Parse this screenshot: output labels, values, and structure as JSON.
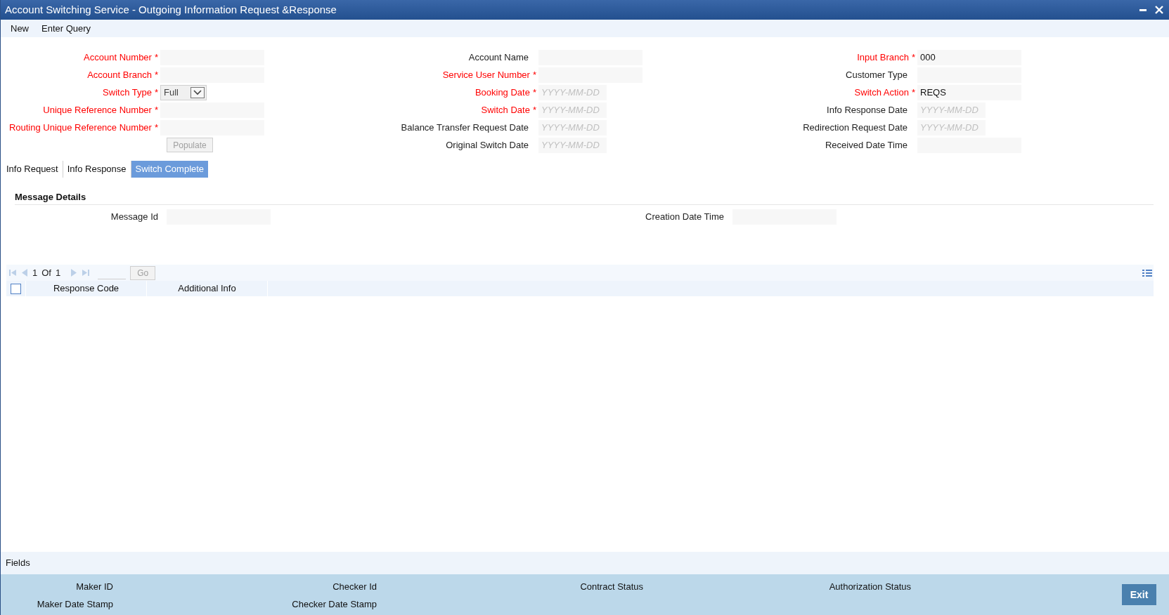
{
  "window": {
    "title": "Account Switching Service - Outgoing Information Request &Response"
  },
  "menu": [
    {
      "label": "New"
    },
    {
      "label": "Enter Query"
    }
  ],
  "required_marker": "*",
  "form_columns": [
    [
      {
        "label": "Account Number",
        "required": true,
        "kind": "text"
      },
      {
        "label": "Account Branch",
        "required": true,
        "kind": "text"
      },
      {
        "label": "Switch Type",
        "required": true,
        "kind": "select",
        "value": "Full"
      },
      {
        "label": "Unique Reference Number",
        "required": true,
        "kind": "text"
      },
      {
        "label": "Routing Unique Reference Number",
        "required": true,
        "kind": "text"
      },
      {
        "label": "Populate",
        "kind": "button"
      }
    ],
    [
      {
        "label": "Account Name",
        "required": false,
        "kind": "text"
      },
      {
        "label": "Service User Number",
        "required": true,
        "kind": "text"
      },
      {
        "label": "Booking Date",
        "required": true,
        "kind": "date",
        "placeholder": "YYYY-MM-DD"
      },
      {
        "label": "Switch Date",
        "required": true,
        "kind": "date",
        "placeholder": "YYYY-MM-DD"
      },
      {
        "label": "Balance Transfer Request Date",
        "required": false,
        "kind": "date",
        "placeholder": "YYYY-MM-DD"
      },
      {
        "label": "Original Switch Date",
        "required": false,
        "kind": "date",
        "placeholder": "YYYY-MM-DD"
      }
    ],
    [
      {
        "label": "Input Branch",
        "required": true,
        "kind": "text",
        "value": "000"
      },
      {
        "label": "Customer Type",
        "required": false,
        "kind": "text"
      },
      {
        "label": "Switch Action",
        "required": true,
        "kind": "text",
        "value": "REQS"
      },
      {
        "label": "Info Response Date",
        "required": false,
        "kind": "date",
        "placeholder": "YYYY-MM-DD"
      },
      {
        "label": "Redirection Request Date",
        "required": false,
        "kind": "date",
        "placeholder": "YYYY-MM-DD"
      },
      {
        "label": "Received Date Time",
        "required": false,
        "kind": "text"
      }
    ]
  ],
  "tabs": [
    {
      "label": "Info Request",
      "selected": false
    },
    {
      "label": "Info Response",
      "selected": false
    },
    {
      "label": "Switch Complete",
      "selected": true
    }
  ],
  "section": {
    "title": "Message Details",
    "fields": [
      {
        "label": "Message Id"
      },
      {
        "label": "Creation Date Time"
      }
    ]
  },
  "pager": {
    "current": "1",
    "of": "Of",
    "total": "1",
    "go": "Go"
  },
  "table": {
    "select_all_checked": false,
    "columns": [
      "Response Code",
      "Additional Info"
    ]
  },
  "fields_label": "Fields",
  "audit": [
    [
      "Maker ID",
      "Maker Date Stamp"
    ],
    [
      "Checker Id",
      "Checker Date Stamp"
    ],
    [
      "Contract Status"
    ],
    [
      "Authorization Status"
    ]
  ],
  "exit_button": "Exit"
}
